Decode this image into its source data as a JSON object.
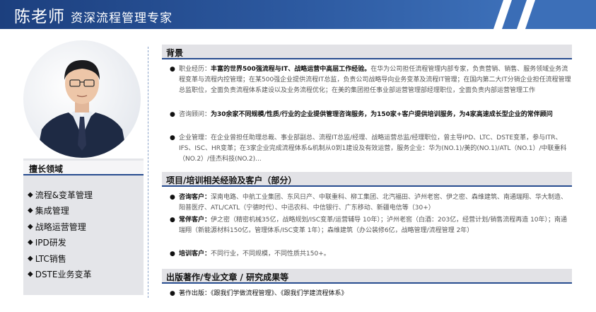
{
  "header": {
    "name": "陈老师",
    "role": "资深流程管理专家",
    "colors": {
      "banner_dark": "#1c3f7e",
      "banner_light": "#3c6fb8",
      "accent": "#274c8f"
    }
  },
  "profile": {
    "photo_icon": "person-portrait-icon"
  },
  "skills": {
    "title": "擅长领域",
    "items": [
      "流程&变革管理",
      "集成管理",
      "战略运营管理",
      "IPD研发",
      "LTC销售",
      "DSTE业务变革"
    ]
  },
  "background": {
    "title": "背景",
    "career_label": "职业经历：",
    "career_bold": "丰富的世界500强流程与IT、战略运营中高层工作经验。",
    "career_text": "在华为公司担任流程管理内部专家，负责营销、销售、服务领域业务流程变革与流程内控管理；在某500强企业提供流程IT总监，负责公司战略导向业务变革及流程IT管理；在国内第二大IT分销企业担任流程管理总监职位，全面负责流程体系建设以及业务流程优化；在美的集团担任事业部运营管理部经理职位，全面负责内部运营管理工作",
    "consult_label": "咨询顾问：",
    "consult_bold": "为30余家不同规模/性质/行业的企业提供管理咨询服务，为150家+客户提供培训服务，为4家高速成长型企业的常伴顾问",
    "enterprise_label": "企业管理：",
    "enterprise_text": "在企业曾担任助理总裁、事业部副总、流程IT总监/经理、战略运营总监/经理职位，曾主导IPD、LTC、DSTE变革，参与ITR、IFS、ISC、HR变革；在3家企业完成流程体系&机制从0到1建设及有效运营，服务企业：华为(NO.1)/美的(NO.1)/ATL（NO.1）/中联重科（NO.2）/佳杰科技(NO.2)..."
  },
  "projects": {
    "title": "项目/培训相关经验及客户（部分）",
    "consult_label": "咨询客户：",
    "consult_text": "深南电路、中航工业集团、东风日产、中联重科、柳工集团、北汽福田、泸州老窖、伊之密、森维建筑、南通瑞翔、华大制造、阳普医疗、ATL/CATL（宁德时代）、中迅农科、中信银行、广东移动、新疆电信等（30+）",
    "resident_label": "常伴客户：",
    "resident_text": "伊之密（精密机械35亿，战略规划/ISC变革/运营辅导 10年）；泸州老窖（白酒：203亿，经营计划/销售流程再造 10年）；南通瑞翔（新能源材料150亿，管理体系/ISC变革 1年）；森维建筑（办公装修6亿，战略管理/流程管理 2年）",
    "training_label": "培训客户：",
    "training_text": "不同行业，不同规模，不同性质共150+。"
  },
  "publications": {
    "title": "出版著作/专业文章 / 研究成果等",
    "label": "著作出版：",
    "text": "《跟我们学做流程管理》、《跟我们学建流程体系》"
  }
}
